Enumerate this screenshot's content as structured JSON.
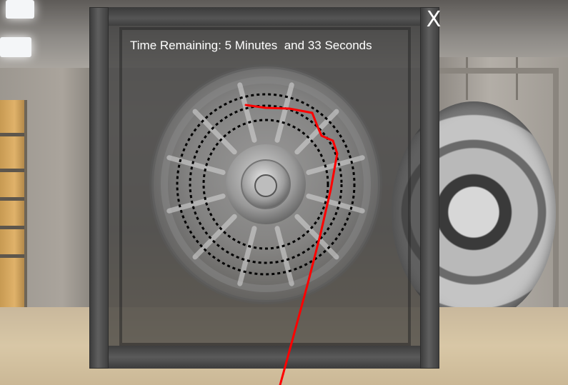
{
  "game": {
    "timer_text": "Time Remaining: 5 Minutes  and 33 Seconds",
    "timer": {
      "minutes": 5,
      "seconds": 33
    },
    "close_label": "X"
  },
  "puzzle": {
    "dial": "vault-door-dial",
    "trace_color": "#ff0000",
    "guide_ring_style": "dotted-black"
  },
  "icons": [
    "close-icon",
    "vault-dial-icon"
  ],
  "colors": {
    "overlay": "#3a3a3a",
    "text": "#ffffff",
    "trace": "#ff0000"
  }
}
